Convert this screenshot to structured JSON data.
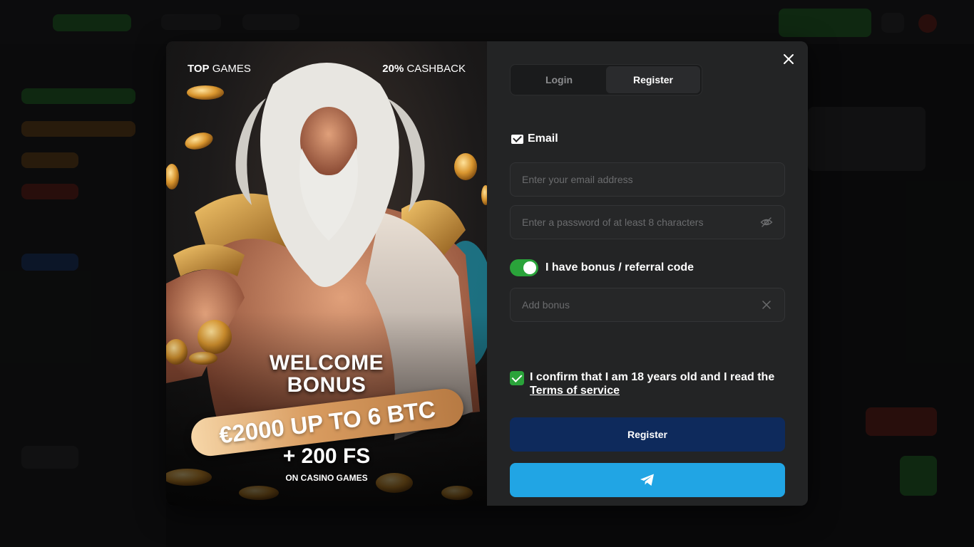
{
  "promo": {
    "top_left_bold": "TOP",
    "top_left_rest": " GAMES",
    "top_right_bold": "20%",
    "top_right_rest": " CASHBACK",
    "welcome_line1": "WELCOME",
    "welcome_line2": "BONUS",
    "ribbon": "€2000 UP TO 6 BTC",
    "free_spins": "+ 200 FS",
    "free_spins_sub": "ON CASINO GAMES"
  },
  "form": {
    "tabs": [
      {
        "label": "Login",
        "active": false
      },
      {
        "label": "Register",
        "active": true
      }
    ],
    "email_label": "Email",
    "email_placeholder": "Enter your email address",
    "password_placeholder": "Enter a password of at least 8 characters",
    "bonus_toggle_label": "I have bonus / referral code",
    "bonus_toggle_on": true,
    "bonus_placeholder": "Add bonus",
    "confirm_text": "I confirm that I am 18 years old and I read the",
    "terms_link": "Terms of service",
    "confirm_checked": true,
    "register_button": "Register",
    "telegram_icon": "telegram-icon"
  },
  "colors": {
    "accent_green": "#2aa33a",
    "register_blue": "#0e2a5c",
    "telegram_blue": "#21a5e4"
  }
}
